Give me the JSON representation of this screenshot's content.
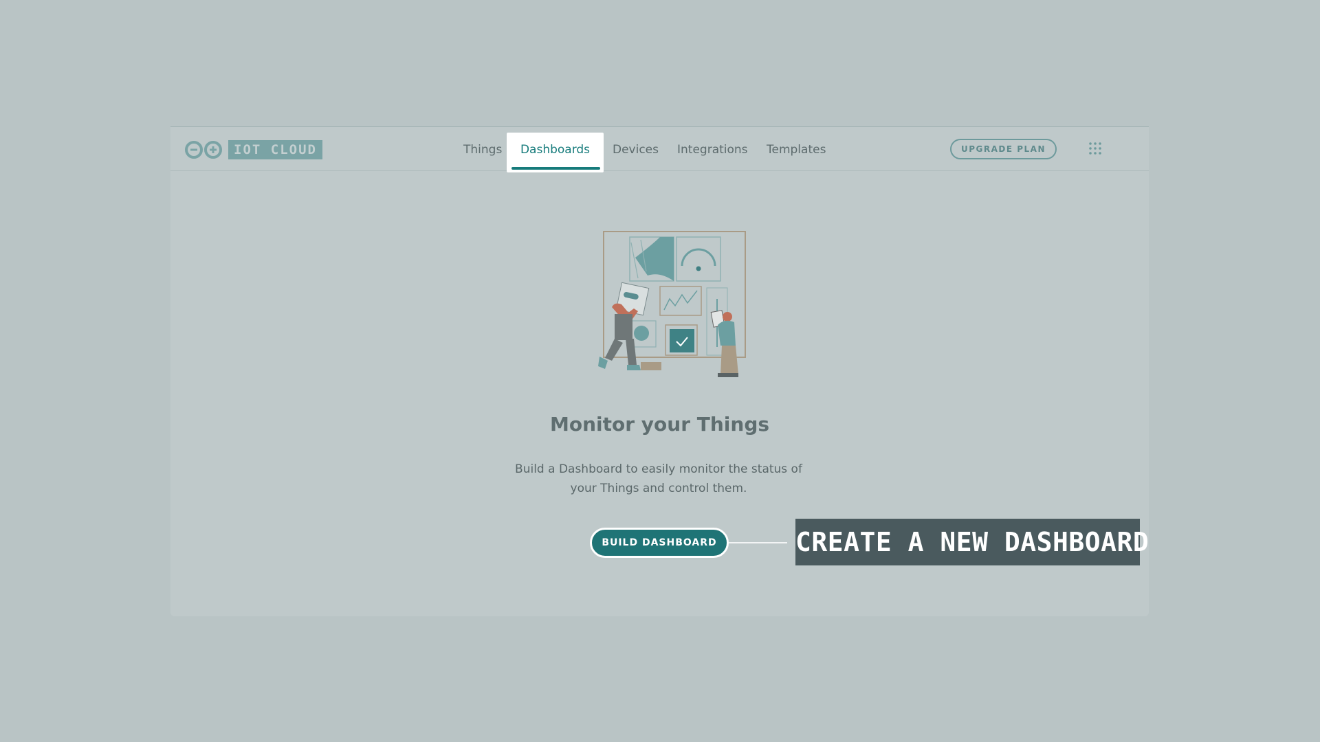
{
  "brand": {
    "logo_text": "IOT CLOUD"
  },
  "nav": {
    "items": [
      {
        "label": "Things"
      },
      {
        "label": "Dashboards",
        "active": true
      },
      {
        "label": "Devices"
      },
      {
        "label": "Integrations"
      },
      {
        "label": "Templates"
      }
    ],
    "upgrade_label": "UPGRADE PLAN"
  },
  "empty_state": {
    "title": "Monitor your Things",
    "description": "Build a Dashboard to easily monitor the status of your Things and control them.",
    "button_label": "BUILD DASHBOARD"
  },
  "callout": {
    "text": "CREATE A NEW DASHBOARD"
  },
  "colors": {
    "accent": "#1f7476",
    "background": "#b9c4c5",
    "panel": "#bfc9ca",
    "callout_bg": "#4a5a5e"
  },
  "icons": [
    "arduino-logo-icon",
    "apps-grid-icon",
    "dashboard-illustration"
  ]
}
